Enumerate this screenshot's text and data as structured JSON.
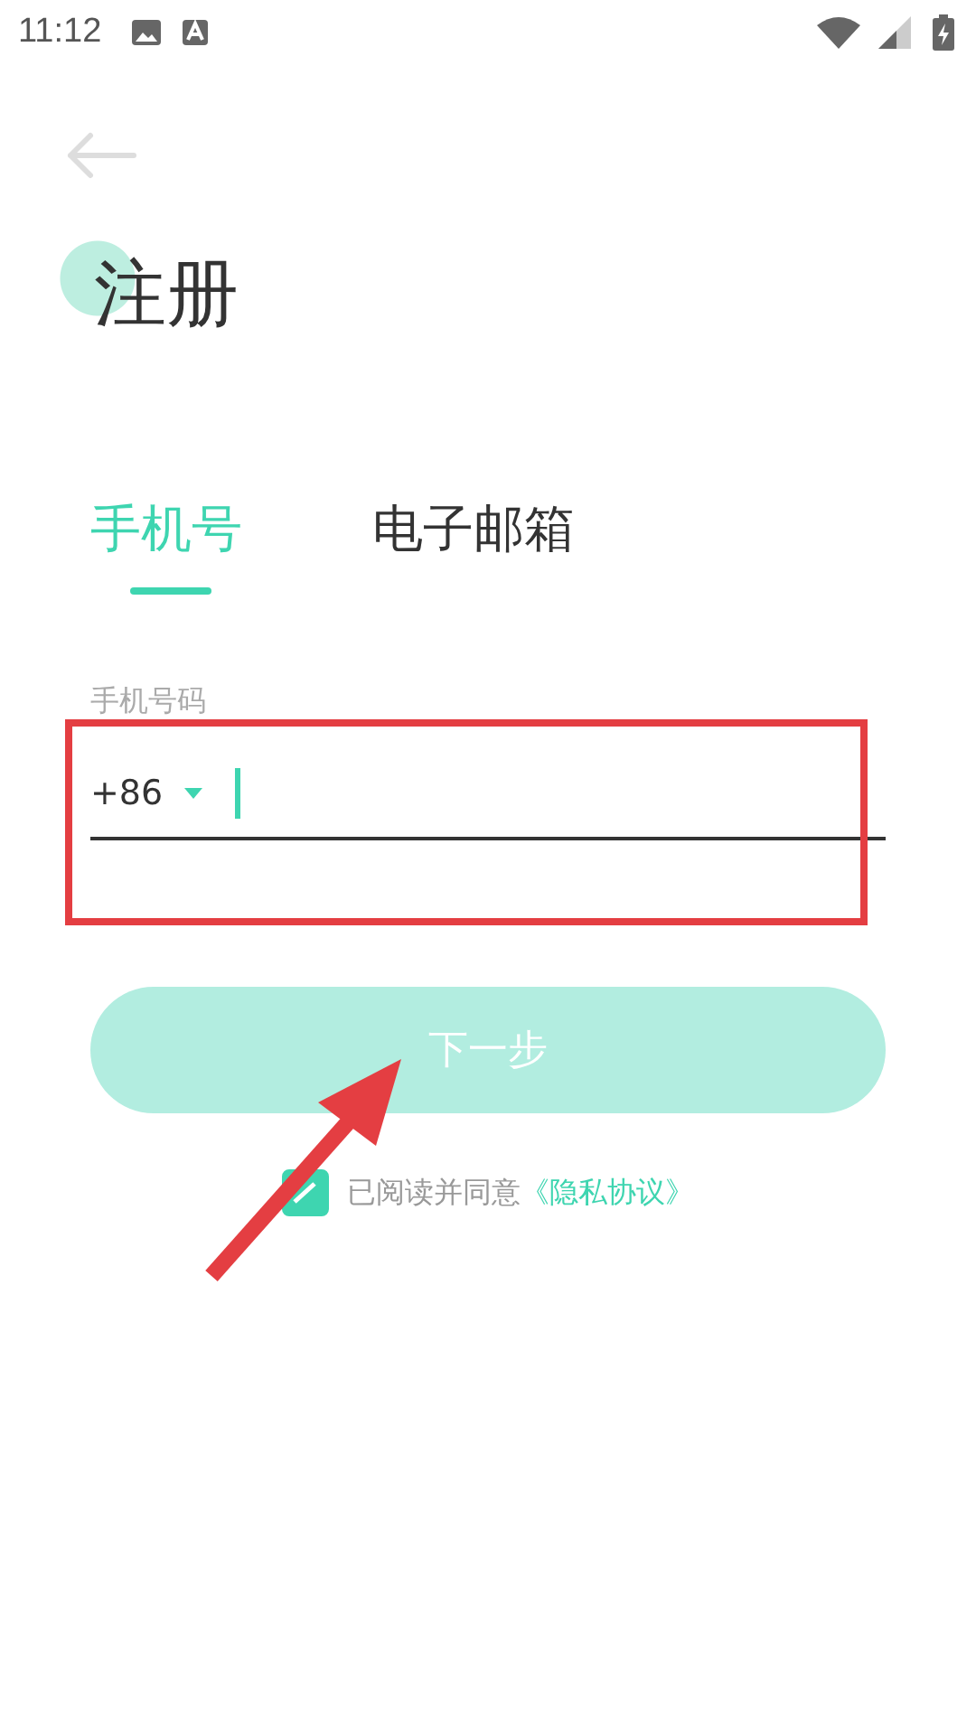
{
  "status_bar": {
    "time": "11:12"
  },
  "title": "注册",
  "tabs": [
    {
      "label": "手机号",
      "selected": true
    },
    {
      "label": "电子邮箱",
      "selected": false
    }
  ],
  "phone_field": {
    "label": "手机号码",
    "country_code": "+86",
    "focused": true
  },
  "next_button": {
    "label": "下一步",
    "disabled": true
  },
  "agreement": {
    "checked": true,
    "text": "已阅读并同意",
    "link": "《隐私协议》"
  }
}
